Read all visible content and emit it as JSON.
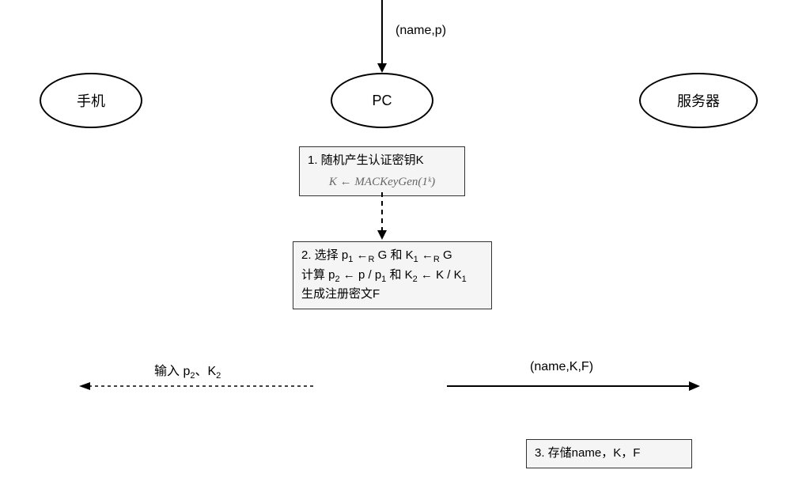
{
  "nodes": {
    "phone": "手机",
    "pc": "PC",
    "server": "服务器"
  },
  "input_top": "(name,p)",
  "step1": {
    "title": "1. 随机产生认证密钥K",
    "formula": "K ← MACKeyGen(1ᵏ)"
  },
  "step2": {
    "line1_a": "2. 选择 p",
    "line1_b": " ←",
    "line1_c": " G 和 K",
    "line1_d": " ←",
    "line1_e": " G",
    "line2_a": "计算 p",
    "line2_b": " ← p / p",
    "line2_c": " 和 K",
    "line2_d": " ← K / K",
    "line3": "生成注册密文F",
    "sub1": "1",
    "sub2": "2",
    "subR": "R"
  },
  "arrow_left_label_a": "输入 p",
  "arrow_left_label_b": "、K",
  "arrow_right_label": "(name,K,F)",
  "step3": "3. 存储name，K，F",
  "chart_data": {
    "type": "diagram",
    "description": "Protocol flow diagram with three actors: Phone, PC, Server",
    "actors": [
      "手机",
      "PC",
      "服务器"
    ],
    "flows": [
      {
        "from": "external",
        "to": "PC",
        "label": "(name,p)",
        "style": "solid"
      },
      {
        "from": "PC",
        "to": "PC",
        "label": "1. 随机产生认证密钥K; K ← MACKeyGen(1^k)",
        "style": "box"
      },
      {
        "from": "step1",
        "to": "step2",
        "label": "",
        "style": "dashed"
      },
      {
        "from": "PC",
        "to": "PC",
        "label": "2. 选择 p1←R G 和 K1←R G; 计算 p2←p/p1 和 K2←K/K1; 生成注册密文F",
        "style": "box"
      },
      {
        "from": "PC",
        "to": "手机",
        "label": "输入 p2、K2",
        "style": "dashed"
      },
      {
        "from": "PC",
        "to": "服务器",
        "label": "(name,K,F)",
        "style": "solid"
      },
      {
        "from": "服务器",
        "to": "服务器",
        "label": "3. 存储name，K，F",
        "style": "box"
      }
    ]
  }
}
